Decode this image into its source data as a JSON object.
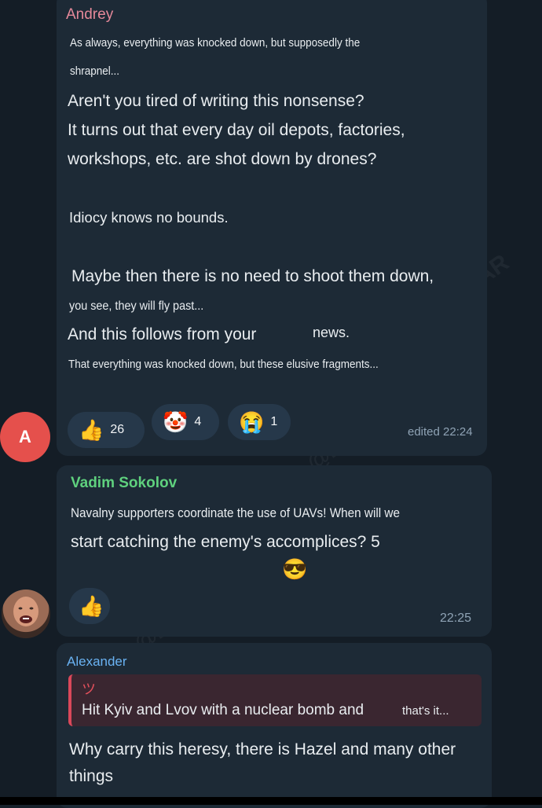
{
  "watermark": "@ZSUWAR",
  "messages": [
    {
      "sender": "Andrey",
      "sender_color": "#e5899a",
      "lines": [
        "As always, everything was knocked down, but supposedly the",
        "shrapnel...",
        "Aren't you tired of writing this nonsense?",
        "It turns out that every day oil depots, factories,",
        "workshops, etc. are shot down by drones?",
        "Idiocy knows no bounds.",
        "Maybe then there is no need to shoot them down,",
        "you see, they will fly past...",
        "And this follows from your",
        "news.",
        "That everything was knocked down, but these elusive fragments..."
      ],
      "reactions": [
        {
          "icon": "thumbs-up",
          "glyph": "👍",
          "count": "26"
        },
        {
          "icon": "clown-face",
          "glyph": "🤡",
          "count": "4"
        },
        {
          "icon": "crying-face",
          "glyph": "😭",
          "count": "1"
        }
      ],
      "time": "edited 22:24",
      "avatar_letter": "A",
      "avatar_color": "#e5504c"
    },
    {
      "sender": "Vadim Sokolov",
      "sender_color": "#5fd17e",
      "lines": [
        "Navalny supporters coordinate the use of UAVs! When will we",
        "start catching the enemy's accomplices? 5"
      ],
      "emoji": "😎",
      "reactions": [
        {
          "icon": "thumbs-up",
          "glyph": "👍",
          "count": ""
        }
      ],
      "time": "22:25"
    },
    {
      "sender": "Alexander",
      "sender_color": "#6ab3f3",
      "reply": {
        "title": "ツ",
        "text_main": "Hit Kyiv and Lvov with a nuclear bomb and",
        "text_small": "that's it..."
      },
      "lines": [
        "Why carry this heresy, there is Hazel and many other",
        "things"
      ]
    }
  ]
}
